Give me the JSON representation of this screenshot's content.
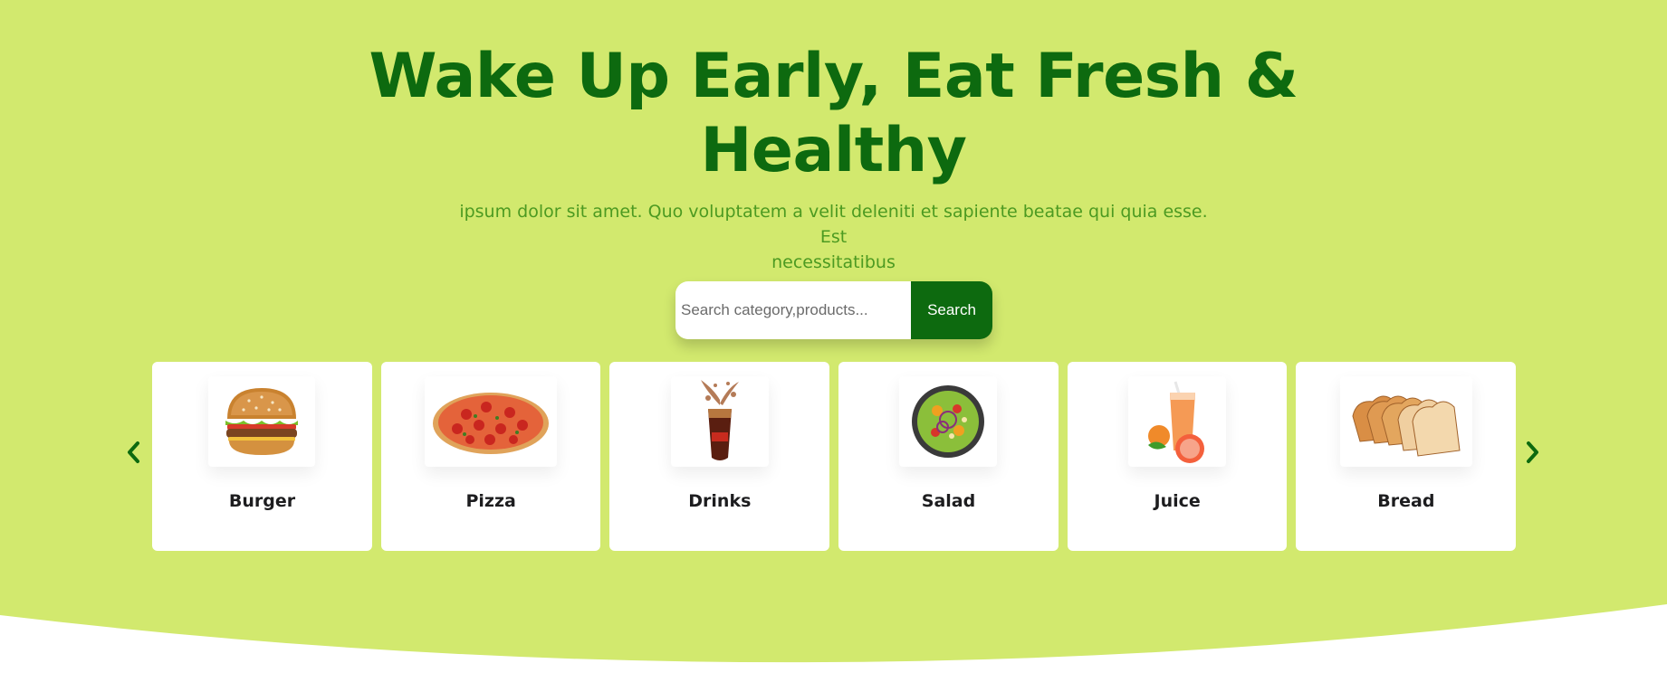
{
  "hero": {
    "headline_line1": "Wake Up Early, Eat Fresh &",
    "headline_line2": "Healthy",
    "subtitle_line1": "ipsum dolor sit amet. Quo voluptatem a velit deleniti et sapiente beatae qui quia esse. Est",
    "subtitle_line2": "necessitatibus"
  },
  "search": {
    "placeholder": "Search category,products...",
    "value": "",
    "button_label": "Search"
  },
  "carousel": {
    "prev_icon": "chevron-left-icon",
    "next_icon": "chevron-right-icon",
    "categories": [
      {
        "label": "Burger",
        "icon": "burger-image"
      },
      {
        "label": "Pizza",
        "icon": "pizza-image"
      },
      {
        "label": "Drinks",
        "icon": "drink-image"
      },
      {
        "label": "Salad",
        "icon": "salad-image"
      },
      {
        "label": "Juice",
        "icon": "juice-image"
      },
      {
        "label": "Bread",
        "icon": "bread-image"
      }
    ]
  },
  "colors": {
    "hero_background": "#d2e96e",
    "headline": "#0d6a0f",
    "subtitle": "#4c9a21",
    "button": "#0d6a0f",
    "card": "#ffffff"
  }
}
